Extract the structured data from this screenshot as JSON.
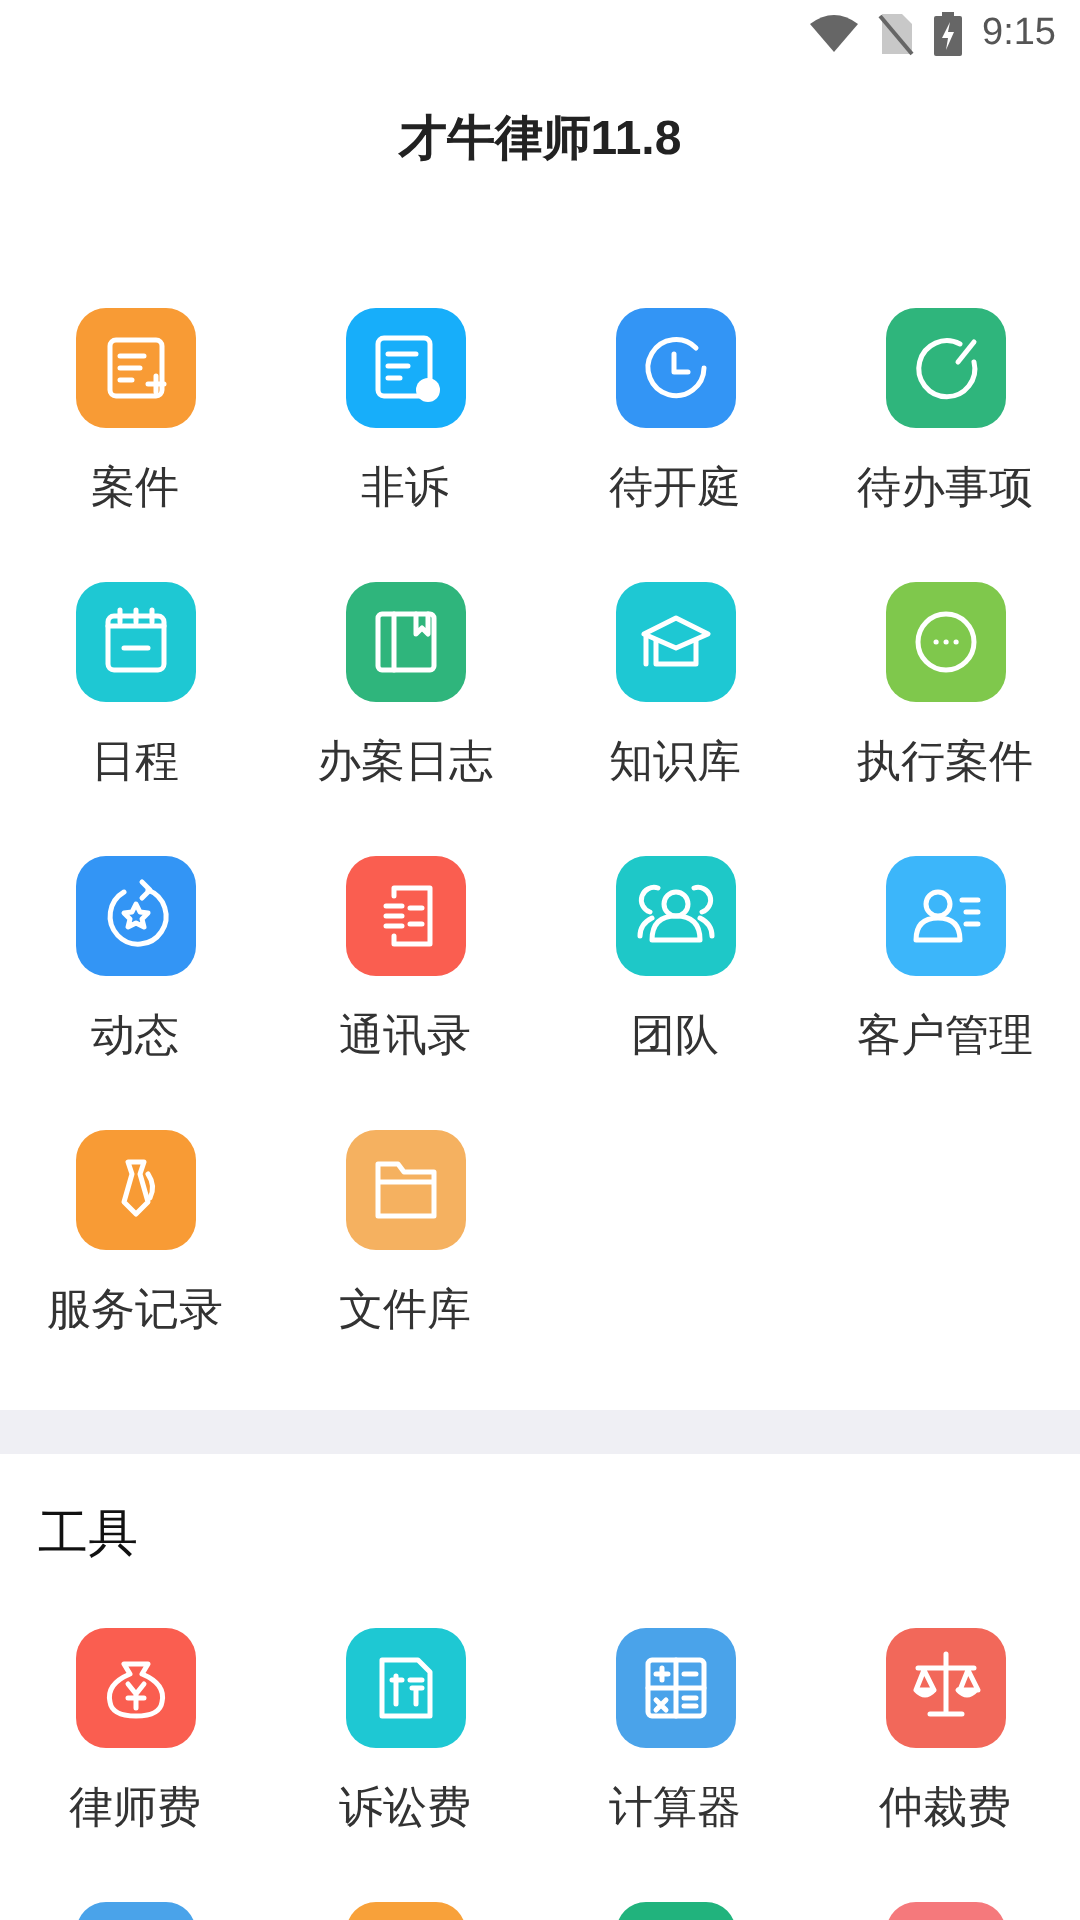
{
  "status_bar": {
    "time": "9:15"
  },
  "title": "才牛律师11.8",
  "work": {
    "items": [
      {
        "label": "案件",
        "color": "#f89b35"
      },
      {
        "label": "非诉",
        "color": "#17aefa"
      },
      {
        "label": "待开庭",
        "color": "#3395f5"
      },
      {
        "label": "待办事项",
        "color": "#2fb57c"
      },
      {
        "label": "日程",
        "color": "#1ec8d3"
      },
      {
        "label": "办案日志",
        "color": "#2fb57c"
      },
      {
        "label": "知识库",
        "color": "#1ec8d3"
      },
      {
        "label": "执行案件",
        "color": "#7fc84c"
      },
      {
        "label": "动态",
        "color": "#3395f5"
      },
      {
        "label": "通讯录",
        "color": "#fa5e50"
      },
      {
        "label": "团队",
        "color": "#1ec8c8"
      },
      {
        "label": "客户管理",
        "color": "#3cb6fa"
      },
      {
        "label": "服务记录",
        "color": "#f89b35"
      },
      {
        "label": "文件库",
        "color": "#f5b160"
      }
    ]
  },
  "tools": {
    "title": "工具",
    "items": [
      {
        "label": "律师费",
        "color": "#fa5e50"
      },
      {
        "label": "诉讼费",
        "color": "#1ec8d3"
      },
      {
        "label": "计算器",
        "color": "#4aa3ea"
      },
      {
        "label": "仲裁费",
        "color": "#f2685a"
      }
    ],
    "partial_row": [
      {
        "color": "#4aa3ea"
      },
      {
        "color": "#f8a13a"
      },
      {
        "color": "#21b37d"
      },
      {
        "color": "#f5797c"
      }
    ]
  }
}
